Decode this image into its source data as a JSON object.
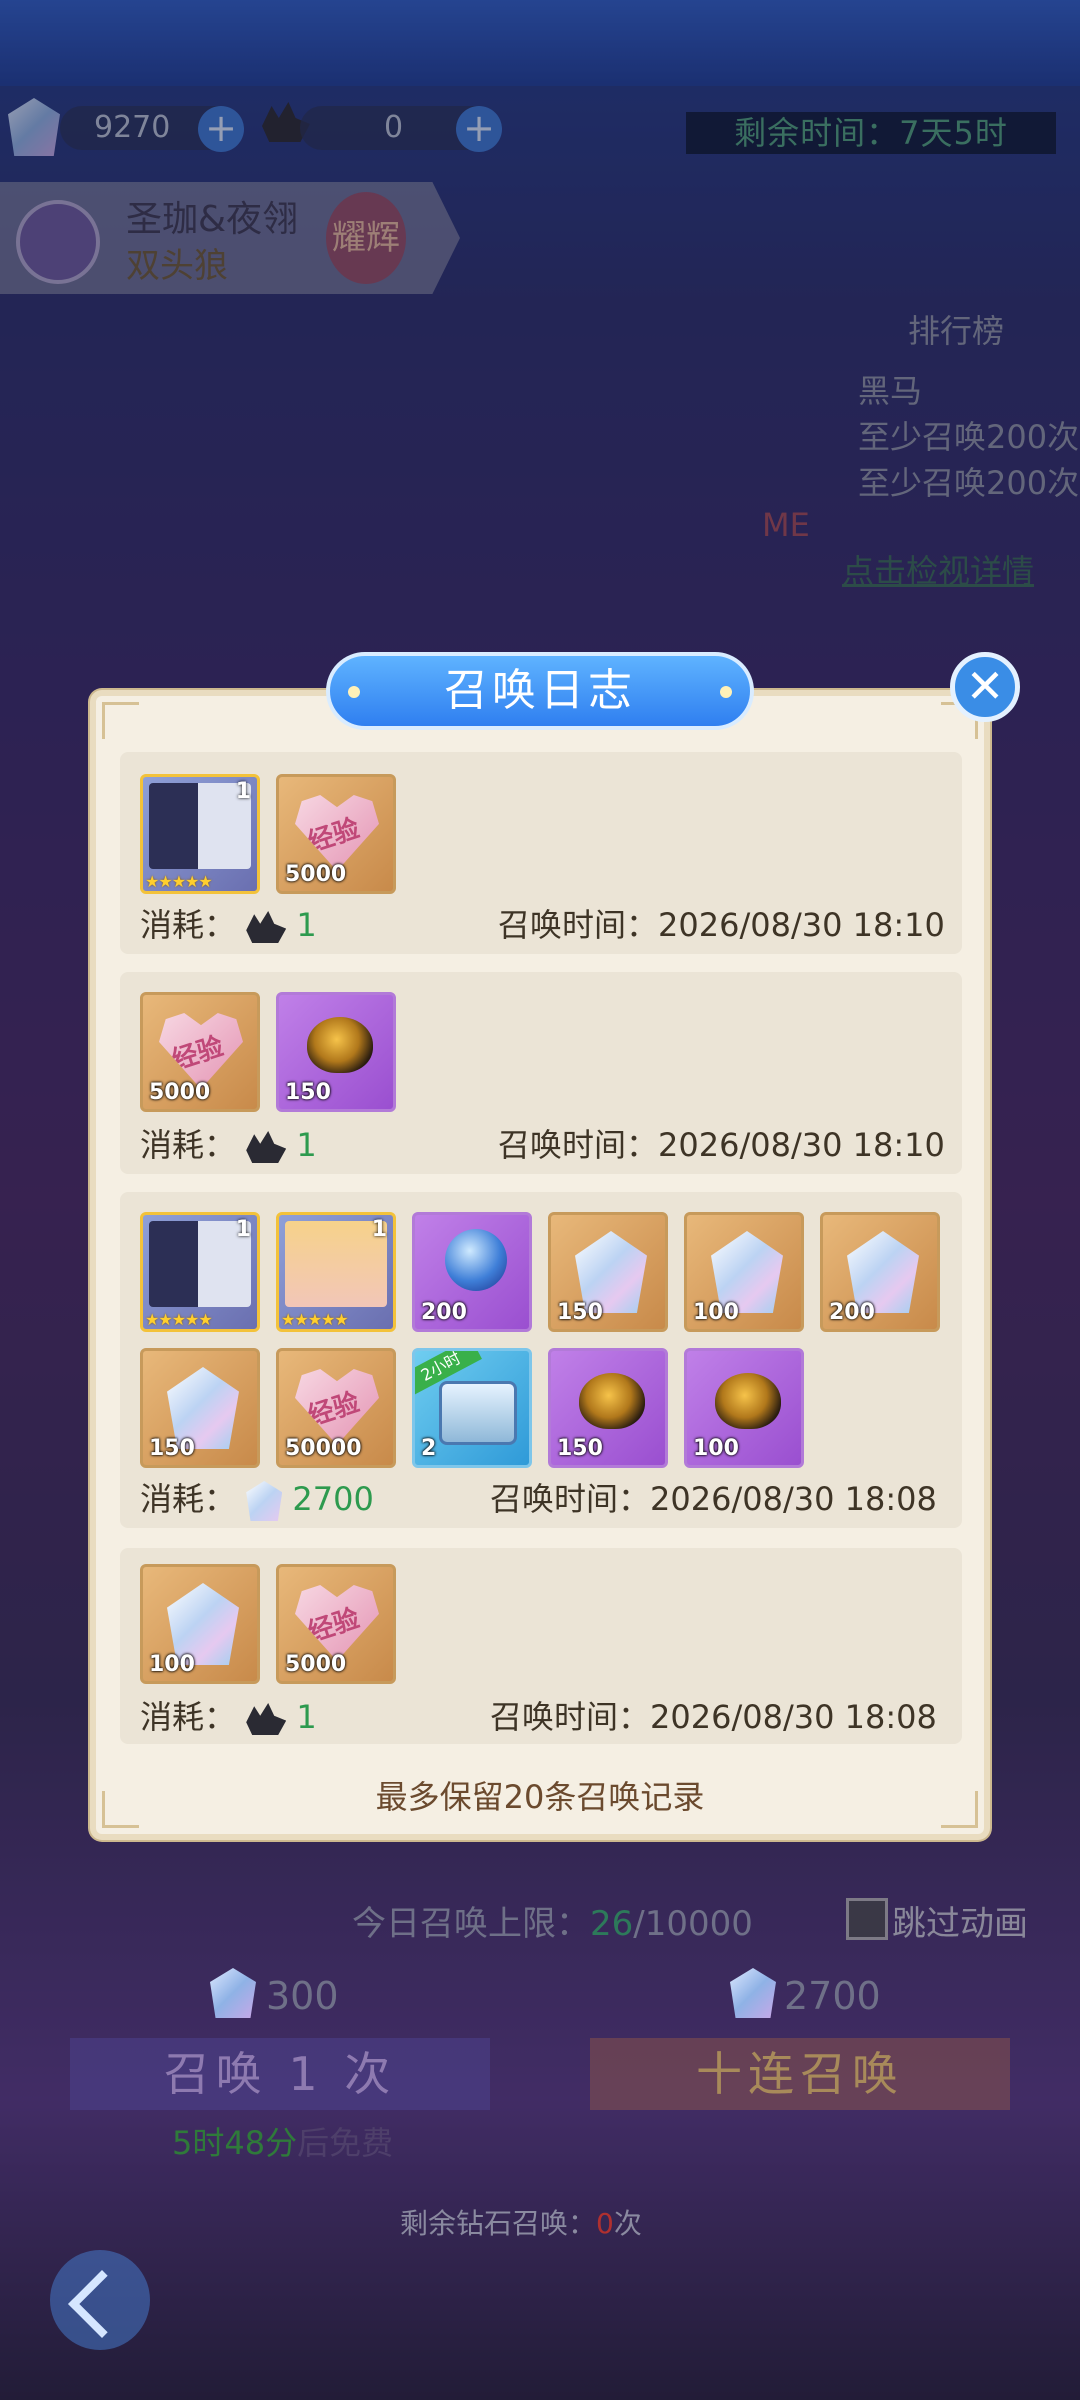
{
  "top": {
    "gems_count": "9270",
    "tickets_count": "0",
    "plus_label": "+",
    "remaining_time": "剩余时间：7天5时"
  },
  "banner": {
    "name": "圣珈&夜翎",
    "sub": "双头狼",
    "tag": "耀辉"
  },
  "ranking": {
    "title": "排行榜",
    "r1": "黑马",
    "r2": "至少召唤200次",
    "r3": "至少召唤200次",
    "me": "ME",
    "link": "点击检视详情"
  },
  "dialog": {
    "title": "召唤日志",
    "close_label": "✕",
    "consume_label": "消耗：",
    "time_label": "召唤时间：",
    "footer_note": "最多保留20条召唤记录",
    "records": [
      {
        "items": [
          {
            "kind": "character",
            "level": "1",
            "stars": "★★★★★"
          },
          {
            "kind": "exp",
            "label": "经验",
            "count": "5000"
          }
        ],
        "cost": "1",
        "time": "2026/08/30 18:10"
      },
      {
        "items": [
          {
            "kind": "exp",
            "label": "经验",
            "count": "5000"
          },
          {
            "kind": "egg",
            "count": "150"
          }
        ],
        "cost": "1",
        "time": "2026/08/30 18:10"
      },
      {
        "items": [
          {
            "kind": "character",
            "level": "1",
            "stars": "★★★★★"
          },
          {
            "kind": "character-blonde",
            "level": "1",
            "stars": "★★★★★"
          },
          {
            "kind": "orb",
            "count": "200"
          },
          {
            "kind": "crystal",
            "count": "150"
          },
          {
            "kind": "crystal",
            "count": "100"
          },
          {
            "kind": "crystal",
            "count": "200"
          },
          {
            "kind": "crystal",
            "count": "150"
          },
          {
            "kind": "exp",
            "label": "经验",
            "count": "50000"
          },
          {
            "kind": "chest",
            "badge": "2小时",
            "count": "2"
          },
          {
            "kind": "egg",
            "count": "150"
          },
          {
            "kind": "egg",
            "count": "100"
          }
        ],
        "cost": "2700",
        "time": "2026/08/30 18:08"
      },
      {
        "items": [
          {
            "kind": "crystal",
            "count": "100"
          },
          {
            "kind": "exp",
            "label": "经验",
            "count": "5000"
          }
        ],
        "cost": "1",
        "time": "2026/08/30 18:08"
      }
    ]
  },
  "bottom": {
    "daily_limit_label": "今日召唤上限：",
    "daily_used": "26",
    "daily_max": "/10000",
    "skip_anim": "跳过动画",
    "single_cost": "300",
    "ten_cost": "2700",
    "single_btn": "召唤 1 次",
    "ten_btn": "十连召唤",
    "free_timer": "5时48分",
    "free_suffix": "后免费",
    "remaining_diamond_pre": "剩余钻石召唤：",
    "remaining_diamond_num": "0",
    "remaining_diamond_post": "次"
  },
  "colors": {
    "cost_green": "#2d9a4e",
    "dialog_bg": "#f5efe3",
    "title_blue": "#2f7ff0",
    "timer_green": "#4fa07f"
  }
}
